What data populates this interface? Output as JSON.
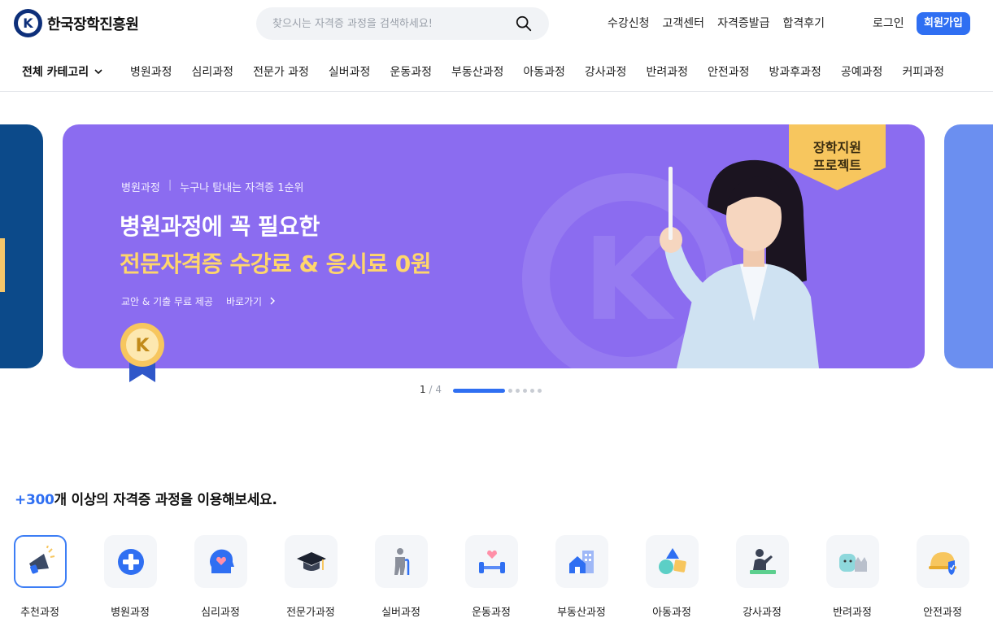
{
  "header": {
    "logo_text": "한국장학진흥원",
    "search_placeholder": "찾으시는 자격증 과정을 검색하세요!",
    "util_links": [
      "수강신청",
      "고객센터",
      "자격증발급",
      "합격후기"
    ],
    "login_label": "로그인",
    "join_label": "회원가입"
  },
  "category_nav": {
    "all_label": "전체 카테고리",
    "items": [
      "병원과정",
      "심리과정",
      "전문가 과정",
      "실버과정",
      "운동과정",
      "부동산과정",
      "아동과정",
      "강사과정",
      "반려과정",
      "안전과정",
      "방과후과정",
      "공예과정",
      "커피과정"
    ]
  },
  "banner": {
    "eyebrow_left": "병원과정",
    "eyebrow_right": "누구나 탐내는 자격증 1순위",
    "title_line1": "병원과정에 꼭 필요한",
    "title_line2": "전문자격증 수강료 & 응시료 0원",
    "sub_left": "교안 & 기출 무료 제공",
    "sub_more": "바로가기",
    "ribbon_line1": "장학지원",
    "ribbon_line2": "프로젝트",
    "colors": {
      "bg": "#8b6cf0",
      "accent": "#ffd66b"
    }
  },
  "pager": {
    "current": "1",
    "total": "4"
  },
  "section": {
    "title_accent": "+300",
    "title_rest": "개 이상의 자격증 과정을 이용해보세요.",
    "categories": [
      {
        "label": "추천과정",
        "icon": "megaphone-icon"
      },
      {
        "label": "병원과정",
        "icon": "medical-cross-icon"
      },
      {
        "label": "심리과정",
        "icon": "head-heart-icon"
      },
      {
        "label": "전문가과정",
        "icon": "graduation-cap-icon"
      },
      {
        "label": "실버과정",
        "icon": "elder-cane-icon"
      },
      {
        "label": "운동과정",
        "icon": "dumbbell-heart-icon"
      },
      {
        "label": "부동산과정",
        "icon": "house-building-icon"
      },
      {
        "label": "아동과정",
        "icon": "toy-shapes-icon"
      },
      {
        "label": "강사과정",
        "icon": "lecturer-icon"
      },
      {
        "label": "반려과정",
        "icon": "pet-icon"
      },
      {
        "label": "안전과정",
        "icon": "safety-helmet-icon"
      }
    ]
  }
}
